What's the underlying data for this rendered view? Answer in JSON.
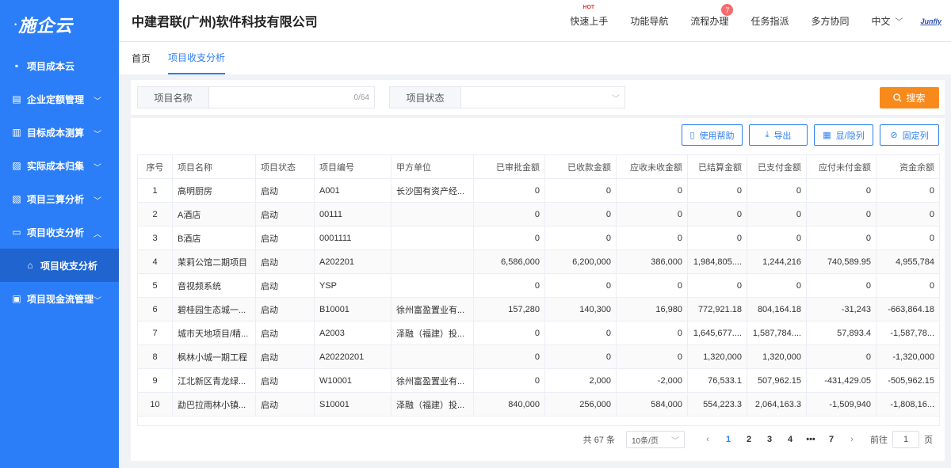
{
  "app": {
    "logo": "施企云"
  },
  "sidebar": {
    "items": [
      {
        "label": "项目成本云",
        "icon": "grid-icon",
        "chevron": ""
      },
      {
        "label": "企业定额管理",
        "icon": "book-icon",
        "chevron": "﹀"
      },
      {
        "label": "目标成本测算",
        "icon": "calc-icon",
        "chevron": "﹀"
      },
      {
        "label": "实际成本归集",
        "icon": "chart-icon",
        "chevron": "﹀"
      },
      {
        "label": "项目三算分析",
        "icon": "report-icon",
        "chevron": "﹀"
      },
      {
        "label": "项目收支分析",
        "icon": "card-icon",
        "chevron": "︿"
      },
      {
        "label": "项目收支分析",
        "icon": "home-icon",
        "chevron": ""
      },
      {
        "label": "项目现金流管理",
        "icon": "cash-icon",
        "chevron": "﹀"
      }
    ]
  },
  "header": {
    "company": "中建君联(广州)软件科技有限公司",
    "nav": [
      {
        "label": "快速上手",
        "hot": "HOT"
      },
      {
        "label": "功能导航"
      },
      {
        "label": "流程办理",
        "badge": "7"
      },
      {
        "label": "任务指派"
      },
      {
        "label": "多方协同"
      }
    ],
    "lang": "中文",
    "brand": "Junfly"
  },
  "tabs": [
    "首页",
    "项目收支分析"
  ],
  "search": {
    "name_label": "项目名称",
    "name_count": "0/64",
    "status_label": "项目状态",
    "button": "搜索"
  },
  "toolbar": {
    "help": "使用帮助",
    "export": "导出",
    "columns": "显/隐列",
    "fix": "固定列"
  },
  "table": {
    "headers": [
      "序号",
      "项目名称",
      "项目状态",
      "项目编号",
      "甲方单位",
      "已审批金额",
      "已收款金额",
      "应收未收金额",
      "已结算金额",
      "已支付金额",
      "应付未付金额",
      "资金余额"
    ],
    "rows": [
      [
        "1",
        "高明厨房",
        "启动",
        "A001",
        "长沙国有资产经...",
        "0",
        "0",
        "0",
        "0",
        "0",
        "0",
        "0"
      ],
      [
        "2",
        "A酒店",
        "启动",
        "00111",
        "",
        "0",
        "0",
        "0",
        "0",
        "0",
        "0",
        "0"
      ],
      [
        "3",
        "B酒店",
        "启动",
        "0001111",
        "",
        "0",
        "0",
        "0",
        "0",
        "0",
        "0",
        "0"
      ],
      [
        "4",
        "茉莉公馆二期项目",
        "启动",
        "A202201",
        "",
        "6,586,000",
        "6,200,000",
        "386,000",
        "1,984,805....",
        "1,244,216",
        "740,589.95",
        "4,955,784"
      ],
      [
        "5",
        "音视频系统",
        "启动",
        "YSP",
        "",
        "0",
        "0",
        "0",
        "0",
        "0",
        "0",
        "0"
      ],
      [
        "6",
        "碧桂园生态城一...",
        "启动",
        "B10001",
        "徐州富盈置业有...",
        "157,280",
        "140,300",
        "16,980",
        "772,921.18",
        "804,164.18",
        "-31,243",
        "-663,864.18"
      ],
      [
        "7",
        "城市天地项目/精...",
        "启动",
        "A2003",
        "泽融（福建）投...",
        "0",
        "0",
        "0",
        "1,645,677....",
        "1,587,784....",
        "57,893.4",
        "-1,587,78..."
      ],
      [
        "8",
        "枫林小城一期工程",
        "启动",
        "A20220201",
        "",
        "0",
        "0",
        "0",
        "1,320,000",
        "1,320,000",
        "0",
        "-1,320,000"
      ],
      [
        "9",
        "江北新区青龙绿...",
        "启动",
        "W10001",
        "徐州富盈置业有...",
        "0",
        "2,000",
        "-2,000",
        "76,533.1",
        "507,962.15",
        "-431,429.05",
        "-505,962.15"
      ],
      [
        "10",
        "勐巴拉雨林小镇...",
        "启动",
        "S10001",
        "泽融（福建）投...",
        "840,000",
        "256,000",
        "584,000",
        "554,223.3",
        "2,064,163.3",
        "-1,509,940",
        "-1,808,16..."
      ]
    ]
  },
  "pagination": {
    "total": "共 67 条",
    "page_size": "10条/页",
    "pages": [
      "1",
      "2",
      "3",
      "4",
      "•••",
      "7"
    ],
    "current": "1",
    "goto_label": "前往",
    "goto_value": "1",
    "goto_suffix": "页"
  }
}
